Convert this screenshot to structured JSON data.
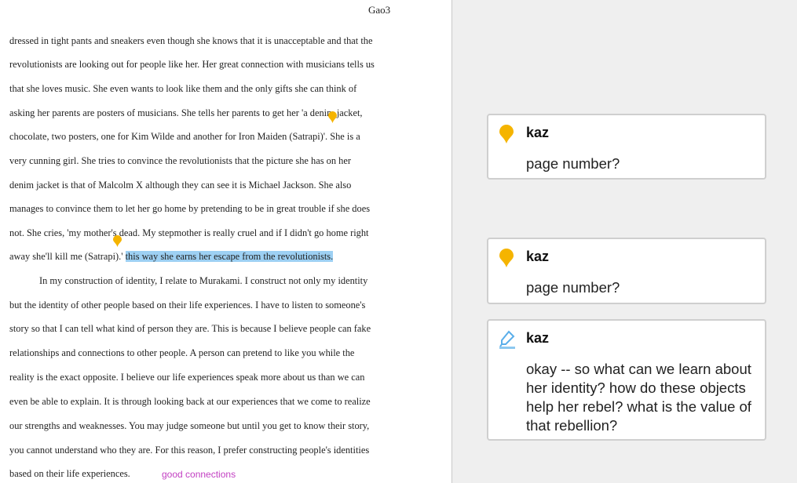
{
  "document": {
    "page_header": "Gao3",
    "paragraph1_lines": [
      "dressed in tight pants and sneakers even though she knows that it is unacceptable and that the",
      "revolutionists are looking out for people like her. Her great connection with musicians tells us",
      "that she loves music. She even wants to look like them and the only gifts she can think of",
      "asking her parents are posters of musicians. She tells her parents to get her 'a denim jacket,",
      "chocolate, two posters, one for Kim Wilde and another for Iron Maiden (Satrapi)'. She is a",
      "very cunning girl. She tries to convince the revolutionists that the picture she has on her",
      "denim jacket is that of Malcolm X although they can see it is Michael Jackson. She also",
      "manages to convince them to let her go home by pretending to be in great trouble if she does",
      "not. She cries, 'my mother's dead. My stepmother is really cruel and if I didn't go home right"
    ],
    "line10_plain": "away she'll kill me (Satrapi).' ",
    "line10_highlighted": "this way she earns her escape from the revolutionists.",
    "paragraph2_lines": [
      "In my construction of identity, I relate to Murakami. I construct not only my identity",
      "but the identity of other people based on their life experiences. I have to listen to someone's",
      "story so that I can tell what kind of person they are. This is because I believe people can fake",
      "relationships and connections to other people. A person can pretend to like you while the",
      "reality is the exact opposite. I believe our life experiences speak more about us than we can",
      "even be able to explain. It is through looking back at our experiences that we come to realize",
      "our strengths and weaknesses. You may judge someone but until you get to know their story,",
      "you cannot understand who they are. For this reason, I prefer constructing people's identities",
      "based on their life experiences."
    ],
    "inline_note": "good connections"
  },
  "comments": [
    {
      "author": "kaz",
      "icon": "map-pin-icon",
      "text": "page number?"
    },
    {
      "author": "kaz",
      "icon": "map-pin-icon",
      "text": "page number?"
    },
    {
      "author": "kaz",
      "icon": "highlighter-pen-icon",
      "text": "okay -- so what can we learn about her identity? how do these objects help her rebel? what is the value of that rebellion?"
    }
  ],
  "colors": {
    "pin": "#f5b400",
    "highlight": "#9dd0f3",
    "pen": "#5aaeea",
    "inline_note": "#c23fc2"
  }
}
